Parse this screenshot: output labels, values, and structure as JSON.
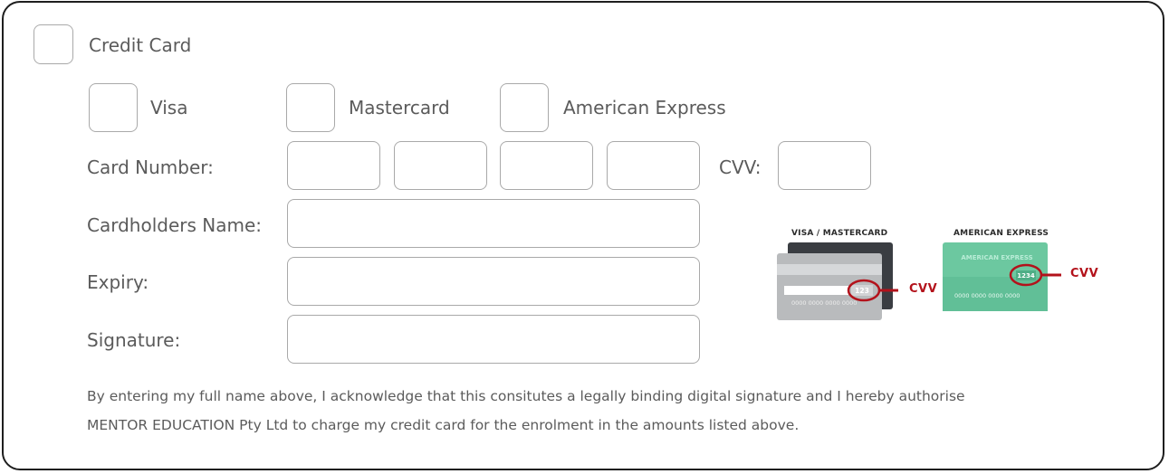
{
  "payment": {
    "credit_card_label": "Credit Card",
    "card_types": [
      {
        "label": "Visa"
      },
      {
        "label": "Mastercard"
      },
      {
        "label": "American Express"
      }
    ],
    "fields": {
      "card_number_label": "Card Number:",
      "cvv_label": "CVV:",
      "cardholder_label": "Cardholders Name:",
      "expiry_label": "Expiry:",
      "signature_label": "Signature:"
    },
    "acknowledgement": {
      "line1": "By entering my full name above, I acknowledge that this consitutes a legally binding digital signature and I hereby authorise",
      "line2": "MENTOR EDUCATION Pty Ltd to charge my credit card for the enrolment in the amounts listed above."
    }
  },
  "cvv_help": {
    "visa_mc": {
      "title": "VISA / MASTERCARD",
      "cvv_sample": "123",
      "card_number": "0000 0000 0000 0000",
      "tag": "CVV"
    },
    "amex": {
      "title": "AMERICAN EXPRESS",
      "brand": "AMERICAN EXPRESS",
      "cvv_sample": "1234",
      "card_number": "0000 0000 0000 0000",
      "tag": "CVV"
    }
  },
  "colors": {
    "border": "#1e1e1e",
    "field_border": "#a9a9a9",
    "text": "#5b5b5b",
    "cvv_accent": "#b3121b",
    "amex_green": "#6cc8a0",
    "card_dark": "#3a3d42",
    "card_grey": "#b9bbbd"
  }
}
